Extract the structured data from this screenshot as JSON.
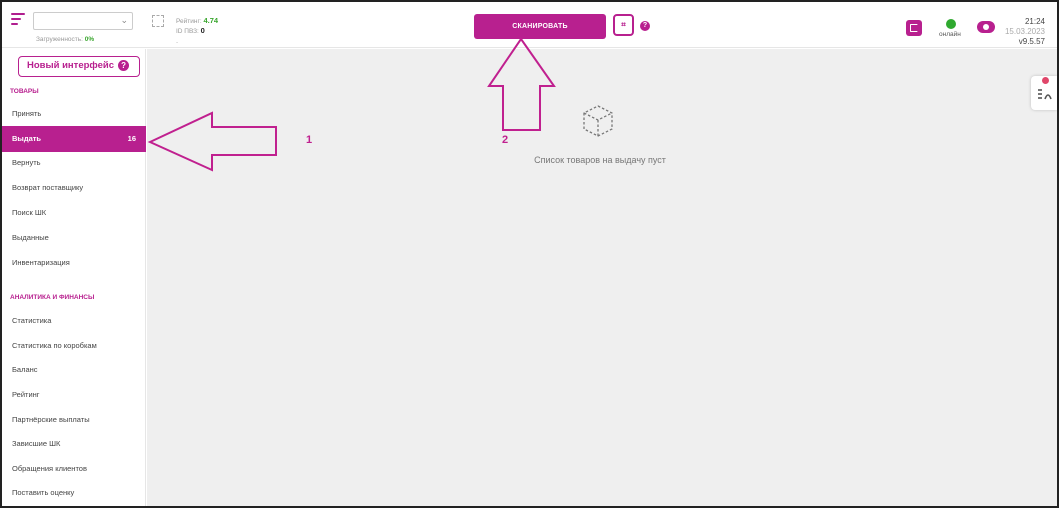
{
  "header": {
    "load_label": "Загруженность:",
    "load_value": "0%",
    "rating_label": "Рейтинг:",
    "rating_value": "4.74",
    "pvz_label": "ID ПВЗ:",
    "pvz_value": "0",
    "dash": "-",
    "scan_label": "СКАНИРОВАТЬ",
    "help_symbol": "?",
    "online_label": "онлайн",
    "time": "21:24",
    "date": "15.03.2023",
    "version": "v9.5.57"
  },
  "sidebar": {
    "new_interface_label": "Новый интерфейс",
    "sections": [
      {
        "title": "ТОВАРЫ"
      },
      {
        "title": "АНАЛИТИКА И ФИНАНСЫ"
      }
    ],
    "goods_items": [
      {
        "label": "Принять"
      },
      {
        "label": "Выдать",
        "count": "16",
        "active": true
      },
      {
        "label": "Вернуть"
      },
      {
        "label": "Возврат поставщику"
      },
      {
        "label": "Поиск ШК"
      },
      {
        "label": "Выданные"
      },
      {
        "label": "Инвентаризация"
      }
    ],
    "finance_items": [
      {
        "label": "Статистика"
      },
      {
        "label": "Статистика по коробкам"
      },
      {
        "label": "Баланс"
      },
      {
        "label": "Рейтинг"
      },
      {
        "label": "Партнёрские выплаты"
      },
      {
        "label": "Зависшие ШК"
      },
      {
        "label": "Обращения клиентов"
      },
      {
        "label": "Поставить оценку"
      }
    ]
  },
  "main": {
    "empty_text": "Список товаров на выдачу пуст"
  },
  "annotations": {
    "label_1": "1",
    "label_2": "2"
  },
  "colors": {
    "accent": "#b8208f",
    "online": "#2fa92f",
    "rating": "#3aa62e"
  }
}
